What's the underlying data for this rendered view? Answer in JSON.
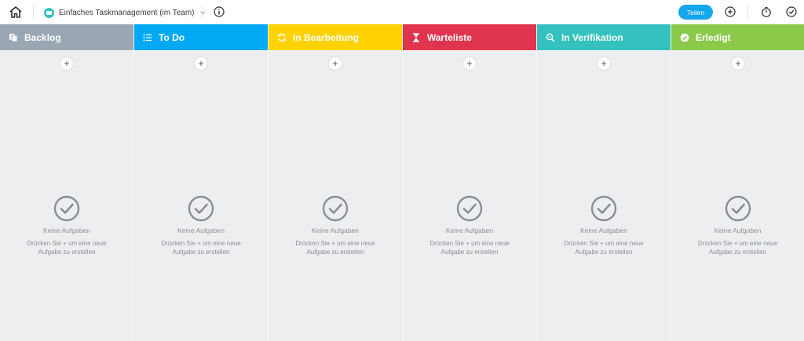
{
  "header": {
    "project_name": "Einfaches Taskmanagement (im Team)",
    "share_label": "Teilen",
    "project_color": "#33c3c5"
  },
  "columns": [
    {
      "title": "Backlog",
      "color": "#9aa7b3",
      "icon": "copy-icon"
    },
    {
      "title": "To Do",
      "color": "#03a9f4",
      "icon": "list-icon"
    },
    {
      "title": "In Bearbeitung",
      "color": "#ffd200",
      "icon": "refresh-icon"
    },
    {
      "title": "Warteliste",
      "color": "#e0344f",
      "icon": "hourglass-icon"
    },
    {
      "title": "In Verifikation",
      "color": "#35c1be",
      "icon": "search-icon"
    },
    {
      "title": "Erledigt",
      "color": "#8bc94b",
      "icon": "check-circle-icon"
    }
  ],
  "empty_state": {
    "title": "Keine Aufgaben",
    "hint": "Drücken Sie + um eine neue Aufgabe zu erstellen"
  }
}
